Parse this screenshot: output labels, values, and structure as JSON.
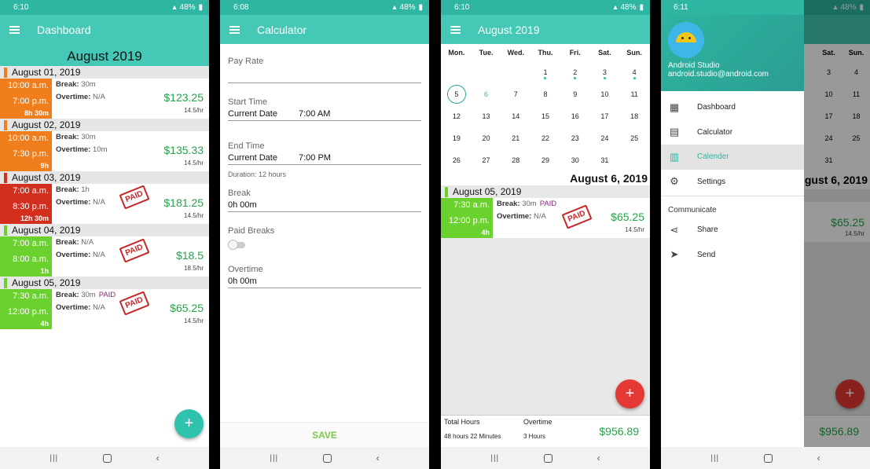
{
  "dashboard": {
    "status_time": "6:10",
    "status_right": "48%",
    "title": "Dashboard",
    "month": "August 2019",
    "days": [
      {
        "date": "August 01, 2019",
        "marker": "#f07e1c",
        "color": "#f07e1c",
        "start": "10:00 a.m.",
        "end": "7:00 p.m.",
        "duration": "8h 30m",
        "break": "30m",
        "paid_label": "",
        "overtime": "N/A",
        "amount": "$123.25",
        "rate": "14.5/hr",
        "stamp": ""
      },
      {
        "date": "August 02, 2019",
        "marker": "#f07e1c",
        "color": "#f07e1c",
        "start": "10:00 a.m.",
        "end": "7:30 p.m.",
        "duration": "9h",
        "break": "30m",
        "paid_label": "",
        "overtime": "10m",
        "amount": "$135.33",
        "rate": "14.5/hr",
        "stamp": ""
      },
      {
        "date": "August 03, 2019",
        "marker": "#d32f1e",
        "color": "#d32f1e",
        "start": "7:00 a.m.",
        "end": "8:30 p.m.",
        "duration": "12h 30m",
        "break": "1h",
        "paid_label": "",
        "overtime": "N/A",
        "amount": "$181.25",
        "rate": "14.5/hr",
        "stamp": "PAID"
      },
      {
        "date": "August 04, 2019",
        "marker": "#6bd12e",
        "color": "#6bd12e",
        "start": "7:00 a.m.",
        "end": "8:00 a.m.",
        "duration": "1h",
        "break": "N/A",
        "paid_label": "",
        "overtime": "N/A",
        "amount": "$18.5",
        "rate": "18.5/hr",
        "stamp": "PAID"
      },
      {
        "date": "August 05, 2019",
        "marker": "#6bd12e",
        "color": "#6bd12e",
        "start": "7:30 a.m.",
        "end": "12:00 p.m.",
        "duration": "4h",
        "break": "30m",
        "paid_label": "PAID",
        "overtime": "N/A",
        "amount": "$65.25",
        "rate": "14.5/hr",
        "stamp": "PAID"
      }
    ],
    "labels": {
      "break": "Break:",
      "overtime": "Overtime:"
    },
    "fab": "+",
    "fab_color": "#2fc3ad"
  },
  "calculator": {
    "status_time": "6:08",
    "status_right": "48%",
    "title": "Calculator",
    "pay_rate_label": "Pay Rate",
    "pay_rate_value": "",
    "start_label": "Start Time",
    "start_date": "Current Date",
    "start_time": "7:00 AM",
    "end_label": "End Time",
    "end_date": "Current Date",
    "end_time": "7:00 PM",
    "duration": "Duration:  12 hours",
    "break_label": "Break",
    "break_value": "0h 00m",
    "paid_breaks_label": "Paid Breaks",
    "overtime_label": "Overtime",
    "overtime_value": "0h 00m",
    "save": "SAVE"
  },
  "calendar": {
    "status_time": "6:10",
    "status_right": "48%",
    "title": "August 2019",
    "weekdays": [
      "Mon.",
      "Tue.",
      "Wed.",
      "Thu.",
      "Fri.",
      "Sat.",
      "Sun."
    ],
    "weeks": [
      [
        "",
        "",
        "",
        "1",
        "2",
        "3",
        "4"
      ],
      [
        "5",
        "6",
        "7",
        "8",
        "9",
        "10",
        "11"
      ],
      [
        "12",
        "13",
        "14",
        "15",
        "16",
        "17",
        "18"
      ],
      [
        "19",
        "20",
        "21",
        "22",
        "23",
        "24",
        "25"
      ],
      [
        "26",
        "27",
        "28",
        "29",
        "30",
        "31",
        ""
      ]
    ],
    "dotted_days": [
      "1",
      "2",
      "3",
      "4"
    ],
    "selected_day": "5",
    "today_day": "6",
    "selected_date": "August 6, 2019",
    "entry": {
      "date": "August 05, 2019",
      "start": "7:30 a.m.",
      "end": "12:00 p.m.",
      "duration": "4h",
      "break": "30m",
      "paid_label": "PAID",
      "overtime": "N/A",
      "amount": "$65.25",
      "rate": "14.5/hr",
      "stamp": "PAID"
    },
    "totals": {
      "hours_label": "Total Hours",
      "hours_value": "48 hours 22 Minutes",
      "overtime_label": "Overtime",
      "overtime_value": "3 Hours",
      "amount": "$956.89"
    },
    "fab": "+",
    "fab_color": "#e53935"
  },
  "drawer": {
    "status_time": "6:11",
    "status_right": "48%",
    "user_name": "Android Studio",
    "user_email": "android.studio@android.com",
    "items": [
      {
        "label": "Dashboard",
        "icon": "dashboard-icon"
      },
      {
        "label": "Calculator",
        "icon": "calculator-icon"
      },
      {
        "label": "Calender",
        "icon": "calendar-icon"
      },
      {
        "label": "Settings",
        "icon": "settings-gear-icon"
      }
    ],
    "section": "Communicate",
    "comm_items": [
      {
        "label": "Share",
        "icon": "share-icon"
      },
      {
        "label": "Send",
        "icon": "send-icon"
      }
    ],
    "bg_weekdays": [
      "Sat.",
      "Sun."
    ],
    "bg_rows": [
      [
        "3",
        "4"
      ],
      [
        "10",
        "11"
      ],
      [
        "17",
        "18"
      ],
      [
        "24",
        "25"
      ],
      [
        "31",
        ""
      ]
    ],
    "bg_date": "gust 6, 2019",
    "bg_amount": "$65.25",
    "bg_rate": "14.5/hr",
    "bg_total": "$956.89"
  }
}
